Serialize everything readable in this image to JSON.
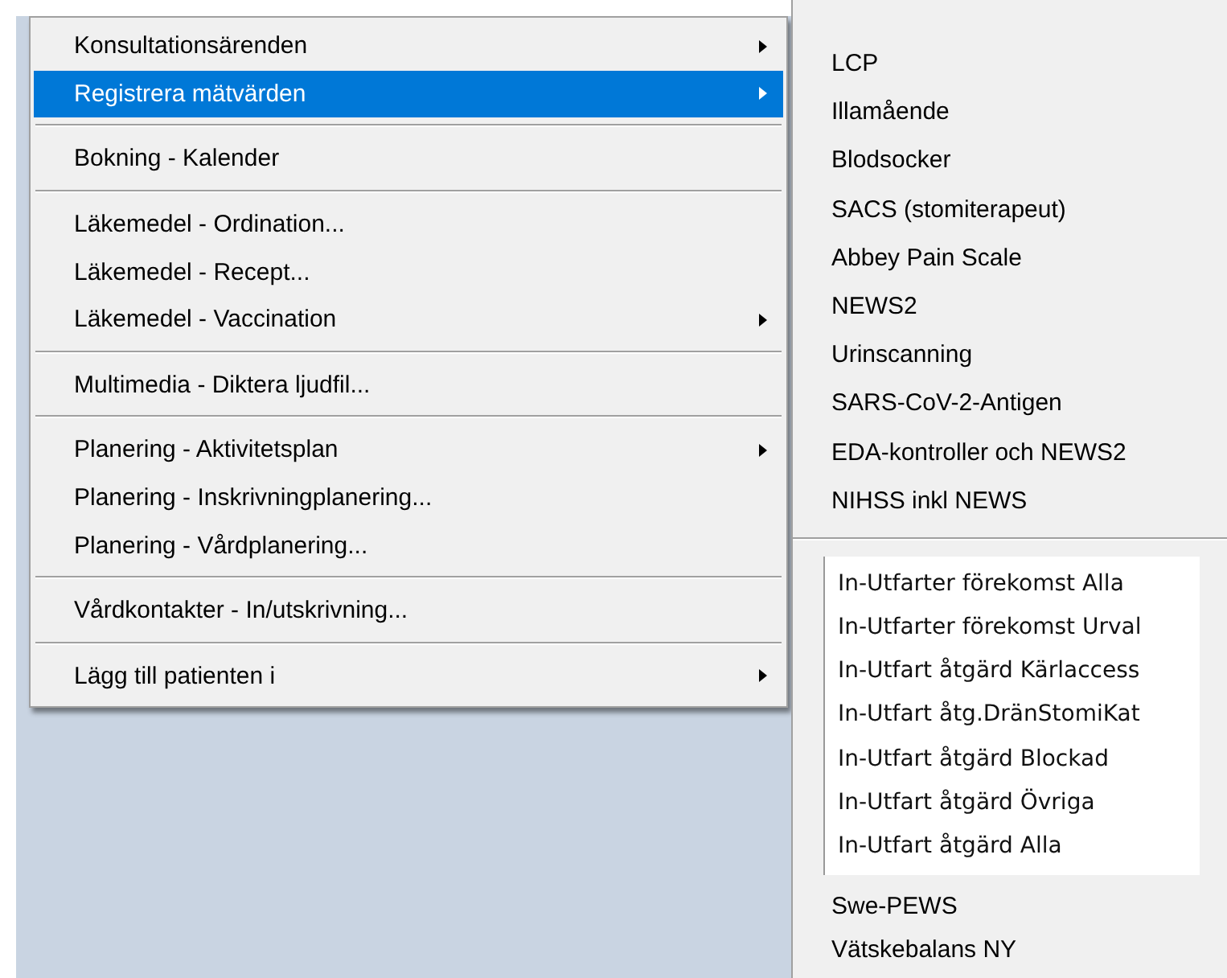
{
  "context_menu": {
    "items": [
      {
        "kind": "item",
        "label": "Konsultationsärenden",
        "submenu": true,
        "selected": false
      },
      {
        "kind": "item",
        "label": "Registrera mätvärden",
        "submenu": true,
        "selected": true
      },
      {
        "kind": "separator"
      },
      {
        "kind": "item",
        "label": "Bokning - Kalender",
        "submenu": false,
        "selected": false
      },
      {
        "kind": "separator"
      },
      {
        "kind": "item",
        "label": "Läkemedel - Ordination...",
        "submenu": false,
        "selected": false
      },
      {
        "kind": "item",
        "label": "Läkemedel - Recept...",
        "submenu": false,
        "selected": false
      },
      {
        "kind": "item",
        "label": "Läkemedel - Vaccination",
        "submenu": true,
        "selected": false
      },
      {
        "kind": "separator"
      },
      {
        "kind": "item",
        "label": "Multimedia - Diktera ljudfil...",
        "submenu": false,
        "selected": false
      },
      {
        "kind": "separator"
      },
      {
        "kind": "item",
        "label": "Planering - Aktivitetsplan",
        "submenu": true,
        "selected": false
      },
      {
        "kind": "item",
        "label": "Planering - Inskrivningplanering...",
        "submenu": false,
        "selected": false
      },
      {
        "kind": "item",
        "label": "Planering - Vårdplanering...",
        "submenu": false,
        "selected": false
      },
      {
        "kind": "separator"
      },
      {
        "kind": "item",
        "label": "Vårdkontakter - In/utskrivning...",
        "submenu": false,
        "selected": false
      },
      {
        "kind": "separator"
      },
      {
        "kind": "item",
        "label": "Lägg till patienten i",
        "submenu": true,
        "selected": false
      }
    ]
  },
  "submenu": {
    "items": [
      {
        "kind": "item",
        "label": "LCP"
      },
      {
        "kind": "item",
        "label": "Illamående"
      },
      {
        "kind": "item",
        "label": "Blodsocker"
      },
      {
        "kind": "item",
        "label": "SACS (stomiterapeut)"
      },
      {
        "kind": "item",
        "label": "Abbey Pain Scale"
      },
      {
        "kind": "item",
        "label": "NEWS2"
      },
      {
        "kind": "item",
        "label": "Urinscanning"
      },
      {
        "kind": "item",
        "label": "SARS-CoV-2-Antigen"
      },
      {
        "kind": "item",
        "label": "EDA-kontroller och NEWS2"
      },
      {
        "kind": "item",
        "label": "NIHSS inkl NEWS"
      },
      {
        "kind": "separator"
      },
      {
        "kind": "panel",
        "items": [
          "In-Utfarter förekomst Alla",
          "In-Utfarter förekomst Urval",
          "In-Utfart åtgärd Kärlaccess",
          "In-Utfart åtg.DränStomiKat",
          "In-Utfart åtgärd Blockad",
          "In-Utfart åtgärd Övriga",
          "In-Utfart åtgärd Alla"
        ]
      },
      {
        "kind": "item",
        "label": "Swe-PEWS"
      },
      {
        "kind": "item",
        "label": "Vätskebalans NY"
      }
    ]
  }
}
